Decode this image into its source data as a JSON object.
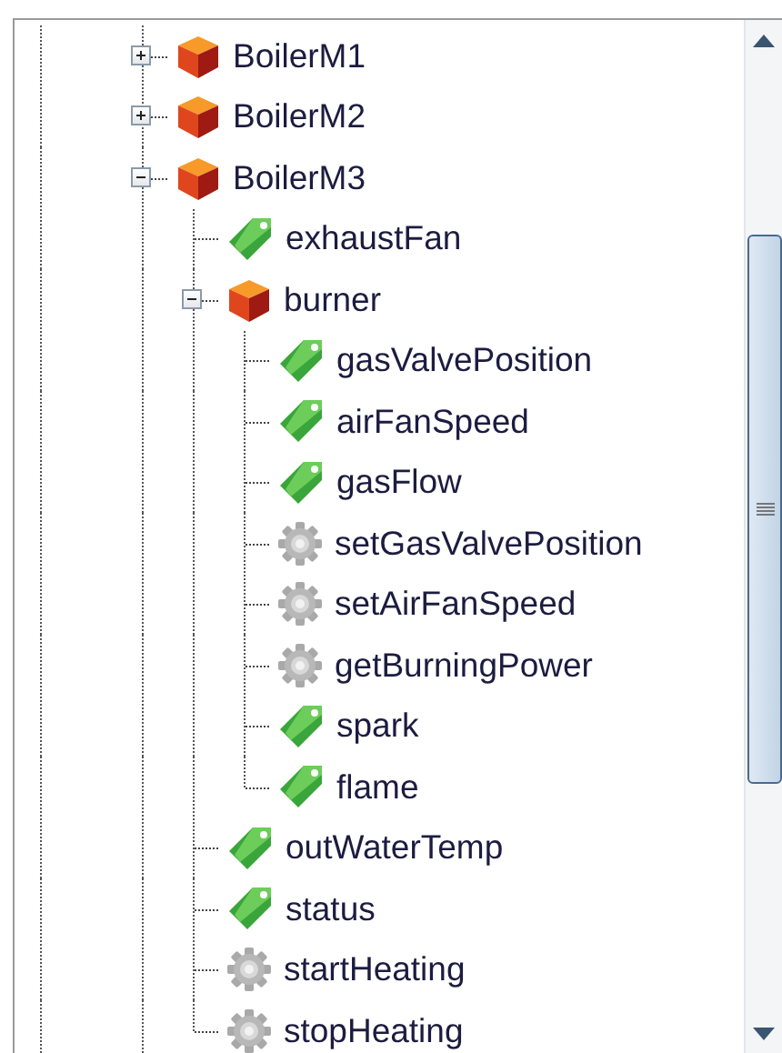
{
  "tree": [
    {
      "label": "BoilerM1",
      "kind": "object",
      "expanded": false
    },
    {
      "label": "BoilerM2",
      "kind": "object",
      "expanded": false
    },
    {
      "label": "BoilerM3",
      "kind": "object",
      "expanded": true,
      "children": [
        {
          "label": "exhaustFan",
          "kind": "variable"
        },
        {
          "label": "burner",
          "kind": "object",
          "expanded": true,
          "children": [
            {
              "label": "gasValvePosition",
              "kind": "variable"
            },
            {
              "label": "airFanSpeed",
              "kind": "variable"
            },
            {
              "label": "gasFlow",
              "kind": "variable"
            },
            {
              "label": "setGasValvePosition",
              "kind": "method"
            },
            {
              "label": "setAirFanSpeed",
              "kind": "method"
            },
            {
              "label": "getBurningPower",
              "kind": "method"
            },
            {
              "label": "spark",
              "kind": "variable"
            },
            {
              "label": "flame",
              "kind": "variable"
            }
          ]
        },
        {
          "label": "outWaterTemp",
          "kind": "variable"
        },
        {
          "label": "status",
          "kind": "variable"
        },
        {
          "label": "startHeating",
          "kind": "method"
        },
        {
          "label": "stopHeating",
          "kind": "method"
        }
      ]
    }
  ]
}
